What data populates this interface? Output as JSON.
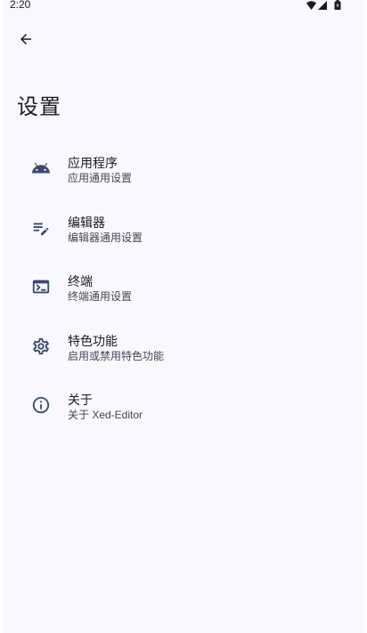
{
  "status_bar": {
    "time": "2:20"
  },
  "header": {
    "title": "设置"
  },
  "settings": {
    "items": [
      {
        "icon": "android-icon",
        "title": "应用程序",
        "subtitle": "应用通用设置"
      },
      {
        "icon": "edit-note-icon",
        "title": "编辑器",
        "subtitle": "编辑器通用设置"
      },
      {
        "icon": "terminal-icon",
        "title": "终端",
        "subtitle": "终端通用设置"
      },
      {
        "icon": "gear-icon",
        "title": "特色功能",
        "subtitle": "启用或禁用特色功能"
      },
      {
        "icon": "info-icon",
        "title": "关于",
        "subtitle": "关于 Xed-Editor"
      }
    ]
  },
  "colors": {
    "icon": "#3b4a6b",
    "background": "#f8f8fe",
    "text": "#1c1b1f"
  }
}
